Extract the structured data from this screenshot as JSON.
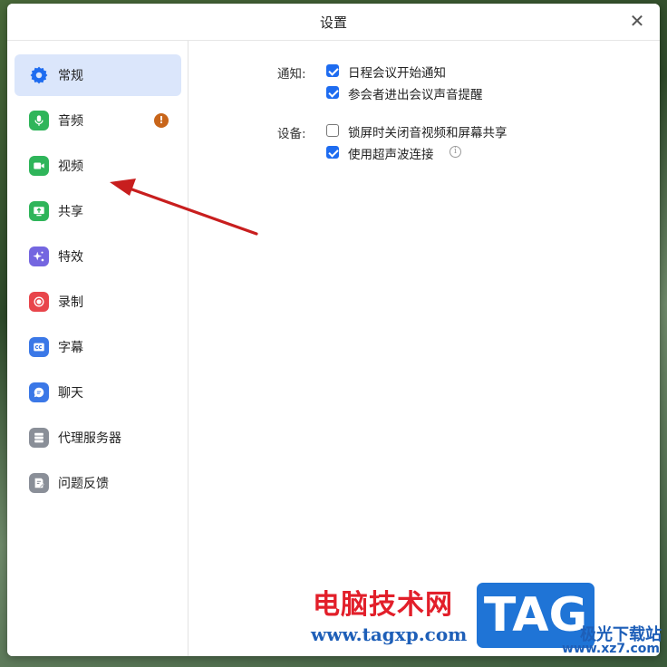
{
  "window": {
    "title": "设置",
    "close_glyph": "✕"
  },
  "sidebar": {
    "items": [
      {
        "label": "常规",
        "icon": "gear-icon",
        "color": "#1e6cf0",
        "active": true
      },
      {
        "label": "音频",
        "icon": "microphone-icon",
        "color": "#2fb55a",
        "badge": "!"
      },
      {
        "label": "视频",
        "icon": "video-camera-icon",
        "color": "#2fb55a"
      },
      {
        "label": "共享",
        "icon": "screen-share-icon",
        "color": "#2fb55a"
      },
      {
        "label": "特效",
        "icon": "sparkle-icon",
        "color": "#7466e0"
      },
      {
        "label": "录制",
        "icon": "record-icon",
        "color": "#e8454b"
      },
      {
        "label": "字幕",
        "icon": "captions-icon",
        "color": "#3b78e7"
      },
      {
        "label": "聊天",
        "icon": "chat-bubble-icon",
        "color": "#3b78e7"
      },
      {
        "label": "代理服务器",
        "icon": "server-icon",
        "color": "#8a8f98"
      },
      {
        "label": "问题反馈",
        "icon": "feedback-icon",
        "color": "#8a8f98"
      }
    ]
  },
  "settings": {
    "notify_label": "通知:",
    "notify_options": [
      {
        "label": "日程会议开始通知",
        "checked": true
      },
      {
        "label": "参会者进出会议声音提醒",
        "checked": true
      }
    ],
    "device_label": "设备:",
    "device_options": [
      {
        "label": "锁屏时关闭音视频和屏幕共享",
        "checked": false
      },
      {
        "label": "使用超声波连接",
        "checked": true,
        "info_glyph": "i"
      }
    ]
  },
  "watermark": {
    "cn_text": "电脑技术网",
    "url": "www.tagxp.com",
    "tag": "TAG",
    "site_cn": "极光下载站",
    "site_url": "www.xz7.com"
  },
  "colors": {
    "accent": "#1e6cf0",
    "active_bg": "#dbe6fb",
    "arrow": "#c81e1e"
  }
}
